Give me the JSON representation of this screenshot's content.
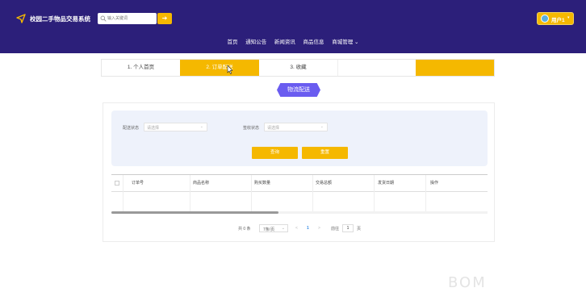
{
  "header": {
    "app_title": "校园二手物品交易系统",
    "search": {
      "placeholder": "输入关键词",
      "value": ""
    },
    "search_button_icon": "arrow-right-icon",
    "user": {
      "name": "用户1",
      "caret": "▾"
    },
    "colors": {
      "header_bg": "#2c1f7a",
      "accent": "#f5b800"
    }
  },
  "nav": {
    "items": [
      {
        "label": "首页"
      },
      {
        "label": "通知公告"
      },
      {
        "label": "新闻资讯"
      },
      {
        "label": "商品信息"
      },
      {
        "label": "商城管理 ⌄"
      }
    ]
  },
  "tabs": [
    {
      "label": "1. 个人首页",
      "active": false
    },
    {
      "label": "2. 订单配送",
      "active": true
    },
    {
      "label": "3. 收藏",
      "active": false
    },
    {
      "label": "",
      "active": false
    },
    {
      "label": "",
      "active": false
    }
  ],
  "section": {
    "title": "物流配送",
    "color": "#6a5cf0"
  },
  "filters": {
    "delivery_status": {
      "label": "配送状态",
      "placeholder": "请选择"
    },
    "sign_status": {
      "label": "签收状态",
      "placeholder": "请选择"
    },
    "query_label": "查询",
    "reset_label": "重置"
  },
  "table": {
    "columns": [
      "订单号",
      "商品名称",
      "购买数量",
      "交易总额",
      "发货日期",
      "操作"
    ],
    "rows": []
  },
  "pagination": {
    "total": "共 0 条",
    "page_size": "7条/页",
    "prev": "<",
    "current_page": "1",
    "next": ">",
    "goto_prefix": "前往",
    "goto_value": "1",
    "goto_suffix": "页"
  },
  "watermark": "BOM"
}
